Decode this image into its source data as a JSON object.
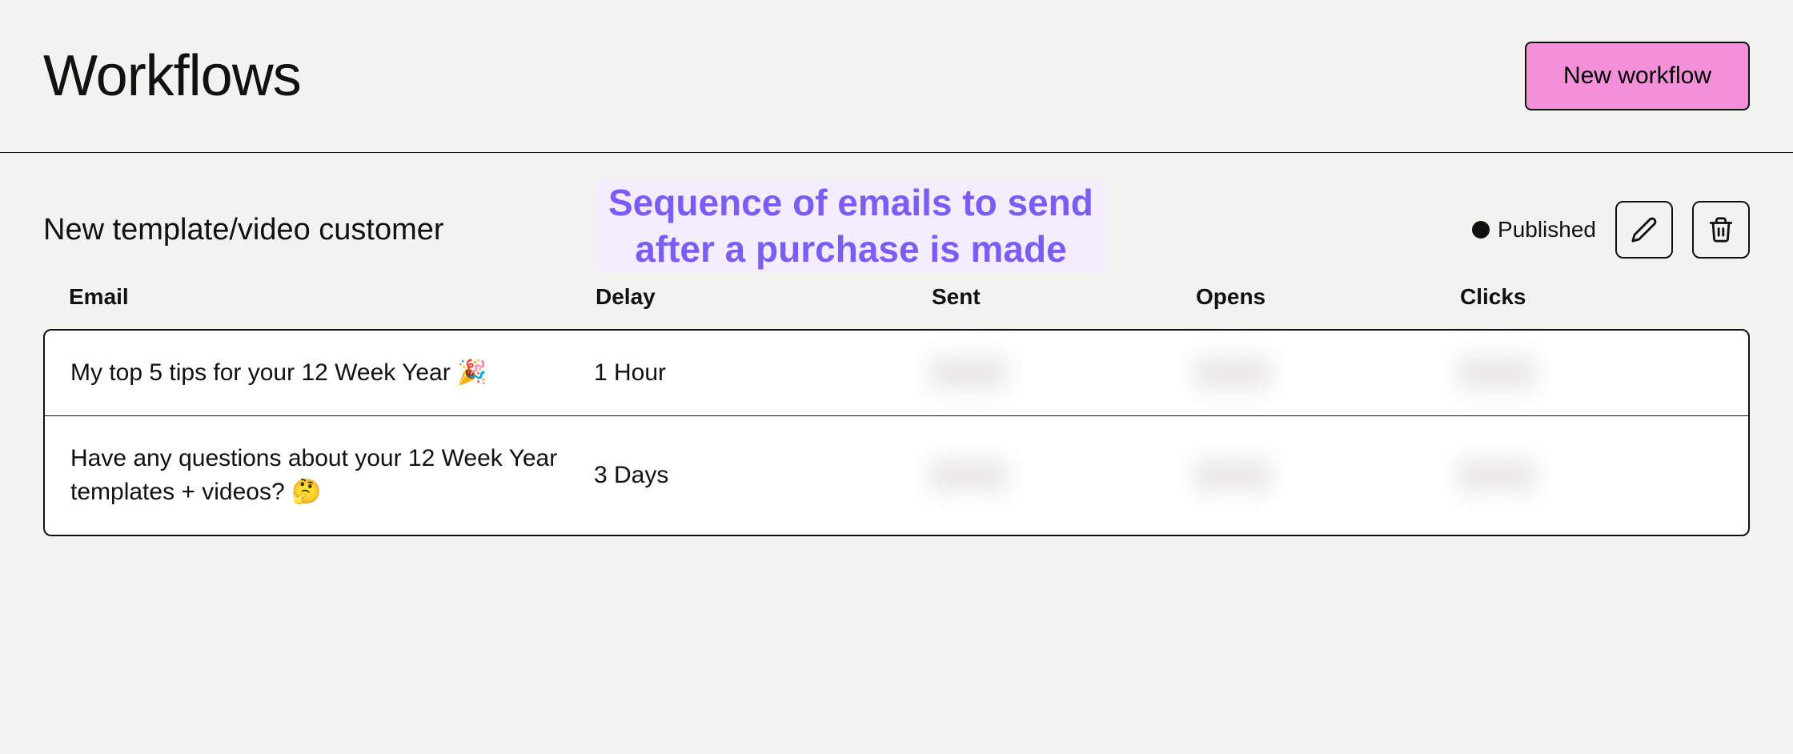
{
  "header": {
    "title": "Workflows",
    "new_workflow_label": "New workflow"
  },
  "workflow": {
    "name": "New template/video customer",
    "annotation": "Sequence of emails to send after a purchase is made",
    "status": "Published",
    "columns": {
      "email": "Email",
      "delay": "Delay",
      "sent": "Sent",
      "opens": "Opens",
      "clicks": "Clicks"
    },
    "rows": [
      {
        "email": "My top 5 tips for your 12 Week Year 🎉",
        "delay": "1 Hour",
        "sent": "",
        "opens": "",
        "clicks": ""
      },
      {
        "email": "Have any questions about your 12 Week Year templates + videos? 🤔",
        "delay": "3 Days",
        "sent": "",
        "opens": "",
        "clicks": ""
      }
    ]
  },
  "icons": {
    "edit": "edit-icon",
    "delete": "delete-icon"
  }
}
